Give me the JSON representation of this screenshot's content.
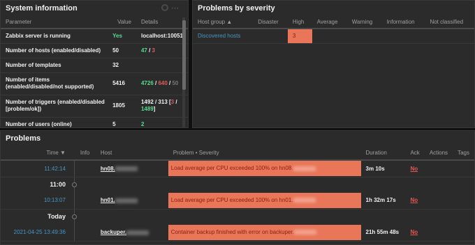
{
  "sysinfo": {
    "title": "System information",
    "headers": [
      "Parameter",
      "Value",
      "Details"
    ],
    "rows": [
      {
        "param": "Zabbix server is running",
        "value": "Yes",
        "details": "localhost:10051"
      },
      {
        "param": "Number of hosts (enabled/disabled)",
        "value": "50",
        "d1": "47",
        "sep1": " / ",
        "d2": "3"
      },
      {
        "param": "Number of templates",
        "value": "32"
      },
      {
        "param": "Number of items (enabled/disabled/not supported)",
        "value": "5416",
        "d1": "4726",
        "sep1": " / ",
        "d2": "640",
        "sep2": " / ",
        "d3": "50"
      },
      {
        "param": "Number of triggers (enabled/disabled [problem/ok])",
        "value": "1805",
        "pre": "1492 / 313 [",
        "d1": "3",
        "sep": " / ",
        "d2": "1489",
        "post": "]"
      },
      {
        "param": "Number of users (online)",
        "value": "5",
        "d1": "2"
      }
    ]
  },
  "severity": {
    "title": "Problems by severity",
    "headers": [
      "Host group ▲",
      "Disaster",
      "High",
      "Average",
      "Warning",
      "Information",
      "Not classified"
    ],
    "rows": [
      {
        "group": "Discovered hosts",
        "disaster": "",
        "high": "3",
        "average": "",
        "warning": "",
        "information": "",
        "not_classified": ""
      }
    ]
  },
  "problems": {
    "title": "Problems",
    "headers": {
      "time": "Time ▼",
      "info": "Info",
      "host": "Host",
      "problem": "Problem • Severity",
      "duration": "Duration",
      "ack": "Ack",
      "actions": "Actions",
      "tags": "Tags"
    },
    "rows": [
      {
        "time": "11:42:14",
        "host": "hn08.",
        "problem": "Load average per CPU exceeded 100% on hn08.",
        "duration": "3m 10s",
        "ack": "No"
      },
      {
        "divider": "11:00"
      },
      {
        "time": "10:13:07",
        "host": "hn01.",
        "problem": "Load average per CPU exceeded 100% on hn01.",
        "duration": "1h 32m 17s",
        "ack": "No"
      },
      {
        "divider": "Today"
      },
      {
        "time": "2021-04-25 13:49:36",
        "host": "backuper.",
        "problem": "Container backup finished with error on backuper.",
        "duration": "21h 55m 48s",
        "ack": "No"
      }
    ]
  },
  "colors": {
    "background": "#0e1012",
    "widget": "#2b2b2b",
    "high_severity": "#e97659",
    "link": "#4796c4",
    "ok_green": "#59db8f",
    "problem_red": "#e45959"
  }
}
